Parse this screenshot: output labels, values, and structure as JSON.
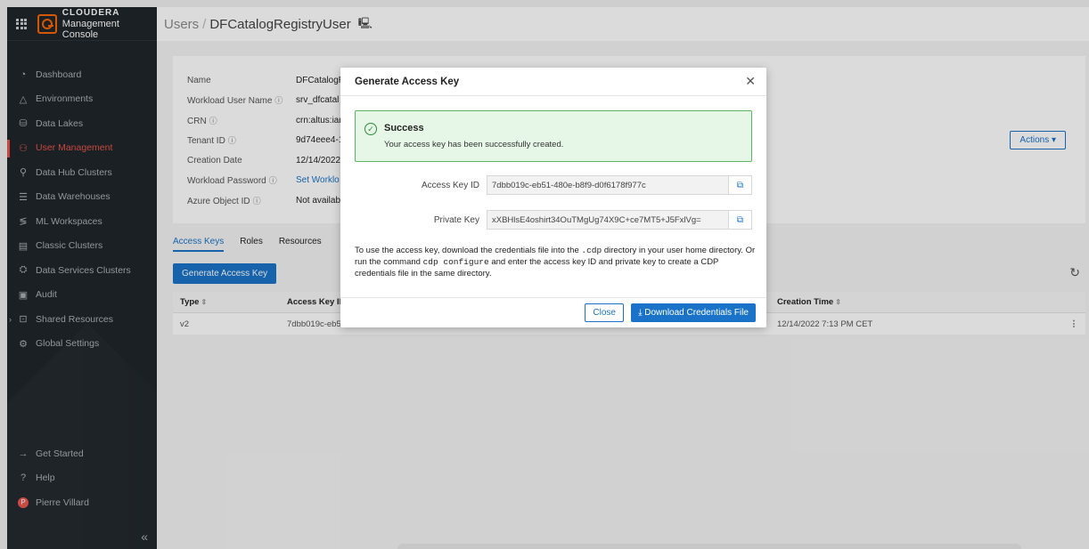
{
  "brand": {
    "top": "CLOUDERA",
    "bottom": "Management Console"
  },
  "sidebar": {
    "items": [
      {
        "label": "Dashboard",
        "icon": "◔"
      },
      {
        "label": "Environments",
        "icon": "△"
      },
      {
        "label": "Data Lakes",
        "icon": "⛁"
      },
      {
        "label": "User Management",
        "icon": "⚇"
      },
      {
        "label": "Data Hub Clusters",
        "icon": "⚲"
      },
      {
        "label": "Data Warehouses",
        "icon": "☰"
      },
      {
        "label": "ML Workspaces",
        "icon": "≶"
      },
      {
        "label": "Classic Clusters",
        "icon": "▤"
      },
      {
        "label": "Data Services Clusters",
        "icon": "⛭"
      },
      {
        "label": "Audit",
        "icon": "▣"
      },
      {
        "label": "Shared Resources",
        "icon": "⊡"
      },
      {
        "label": "Global Settings",
        "icon": "⚙"
      }
    ],
    "bottom": [
      {
        "label": "Get Started",
        "icon": "→"
      },
      {
        "label": "Help",
        "icon": "?"
      },
      {
        "label": "Pierre Villard",
        "icon": "P"
      }
    ],
    "collapse": "«"
  },
  "header": {
    "crumb": "Users",
    "sep": "/",
    "title": "DFCatalogRegistryUser",
    "icon": "🖳"
  },
  "details": {
    "rows": [
      {
        "label": "Name",
        "value": "DFCatalogR",
        "info": ""
      },
      {
        "label": "Workload User Name",
        "value": "srv_dfcatal",
        "info": "ⓘ"
      },
      {
        "label": "CRN",
        "value": "crn:altus:iar",
        "info": "ⓘ"
      },
      {
        "label": "Tenant ID",
        "value": "9d74eee4-1",
        "info": "ⓘ"
      },
      {
        "label": "Creation Date",
        "value": "12/14/2022",
        "info": ""
      },
      {
        "label": "Workload Password",
        "value": "Set Worklo",
        "info": "ⓘ"
      },
      {
        "label": "Azure Object ID",
        "value": "Not availab",
        "info": "ⓘ"
      }
    ],
    "actions": "Actions ▾"
  },
  "tabs": [
    "Access Keys",
    "Roles",
    "Resources"
  ],
  "generate_button": "Generate Access Key",
  "refresh_icon": "↻",
  "table": {
    "headers": {
      "type": "Type",
      "access_key": "Access Key ID",
      "creation": "Creation Time"
    },
    "sort_icon": "⇕",
    "rows": [
      {
        "type": "v2",
        "access_key": "7dbb019c-eb51",
        "creation": "12/14/2022 7:13 PM CET",
        "menu": "⋮"
      }
    ]
  },
  "modal": {
    "title": "Generate Access Key",
    "close_icon": "✕",
    "success_title": "Success",
    "success_msg": "Your access key has been successfully created.",
    "access_key_label": "Access Key ID",
    "access_key_value": "7dbb019c-eb51-480e-b8f9-d0f6178f977c",
    "private_key_label": "Private Key",
    "private_key_value": "xXBHlsE4oshirt34OuTMgUg74X9C+ce7MT5+J5FxlVg=",
    "copy_icon": "⧉",
    "note_1": "To use the access key, download the credentials file into the ",
    "note_code1": ".cdp",
    "note_2": " directory in your user home directory. Or run the command ",
    "note_code2": "cdp configure",
    "note_3": " and enter the access key ID and private key to create a CDP credentials file in the same directory.",
    "close_button": "Close",
    "download_button": "⤓ Download Credentials File"
  },
  "colors": {
    "accent": "#1a73c8",
    "brand": "#f96702",
    "active_nav": "#e8534a",
    "success_bg": "#e6f7e7"
  }
}
